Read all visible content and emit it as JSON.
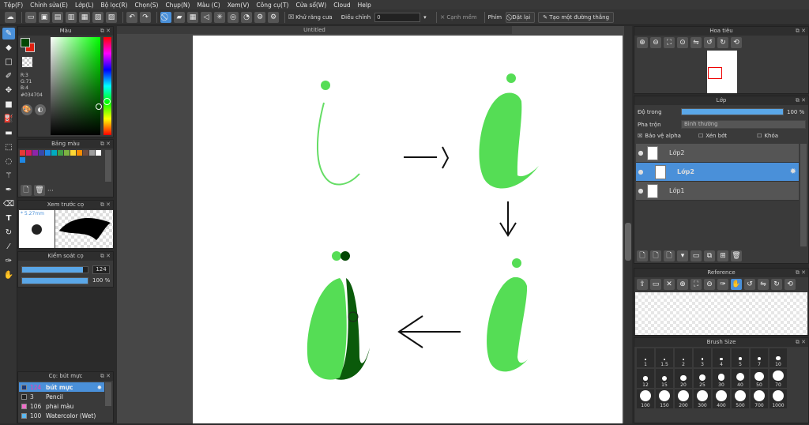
{
  "menu": [
    "Tệp(F)",
    "Chỉnh sửa(E)",
    "Lớp(L)",
    "Bộ lọc(R)",
    "Chọn(S)",
    "Chụp(N)",
    "Màu (C)",
    "Xem(V)",
    "Công cụ(T)",
    "Cửa sổ(W)",
    "Cloud",
    "Help"
  ],
  "toolbar": {
    "antialias_label": "Khử răng cưa",
    "adjust_label": "Điều chỉnh",
    "adjust_value": "0",
    "snap_label": "Cạnh mềm",
    "keys_label": "Phím",
    "reset_label": "Đặt lại",
    "create_guide_label": "Tạo một đường thẳng"
  },
  "color_panel": {
    "title": "Màu",
    "r": "R:3",
    "g": "G:71",
    "b": "B:4",
    "hex": "#034704",
    "fg": "#034704",
    "bg": "#e02010"
  },
  "palette_panel": {
    "title": "Bảng màu",
    "more": "···",
    "colors": [
      "#e53935",
      "#d81b60",
      "#8e24aa",
      "#3949ab",
      "#1e88e5",
      "#00acc1",
      "#43a047",
      "#7cb342",
      "#fdd835",
      "#fb8c00",
      "#6d4c41",
      "#9e9e9e",
      "#ffffff",
      "#1e88e5"
    ]
  },
  "brush_preview": {
    "title": "Xem trước cọ",
    "size": "5.27mm"
  },
  "brush_control": {
    "title": "Kiểm soát cọ",
    "size_value": "124",
    "opacity_value": "100 %",
    "size_fraction": 0.93,
    "opacity_fraction": 1.0
  },
  "brush_list": {
    "title": "Cọ: bút mực",
    "items": [
      {
        "size": "124",
        "name": "bút mực",
        "color": "#1a3a7a",
        "selected": true
      },
      {
        "size": "3",
        "name": "Pencil",
        "color": "#222222",
        "selected": false
      },
      {
        "size": "106",
        "name": "phai màu",
        "color": "#f06cc8",
        "selected": false
      },
      {
        "size": "100",
        "name": "Watercolor (Wet)",
        "color": "#5ab8f0",
        "selected": false
      }
    ]
  },
  "document": {
    "tab": "Untitled"
  },
  "navigator": {
    "title": "Hoa tiêu"
  },
  "layer_panel": {
    "title": "Lớp",
    "opacity_label": "Độ trong",
    "opacity_value": "100 %",
    "opacity_fraction": 1.0,
    "blend_label": "Pha trộn",
    "blend_value": "Bình thường",
    "protect_alpha": "Bảo vệ alpha",
    "clipping": "Xén bớt",
    "lock": "Khóa",
    "layers": [
      {
        "name": "Lớp2",
        "selected": false
      },
      {
        "name": "Lớp2",
        "selected": true
      },
      {
        "name": "Lớp1",
        "selected": false
      }
    ]
  },
  "reference": {
    "title": "Reference"
  },
  "brush_size": {
    "title": "Brush Size",
    "sizes": [
      "1",
      "1.5",
      "2",
      "3",
      "4",
      "5",
      "7",
      "10",
      "12",
      "15",
      "20",
      "25",
      "30",
      "40",
      "50",
      "70",
      "100",
      "150",
      "200",
      "300",
      "400",
      "500",
      "700",
      "1000"
    ]
  }
}
